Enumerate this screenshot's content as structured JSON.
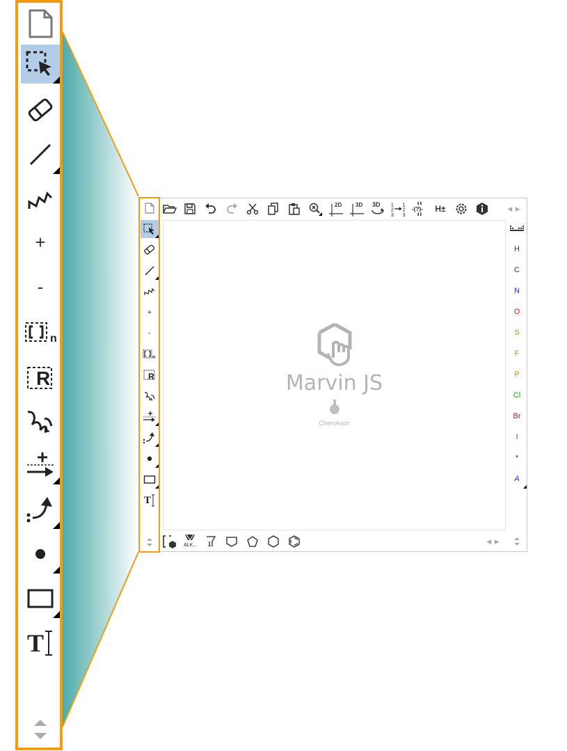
{
  "zoom_toolbar": {
    "tools": [
      {
        "name": "new-document"
      },
      {
        "name": "rectangle-select",
        "active": true
      },
      {
        "name": "eraser"
      },
      {
        "name": "single-bond"
      },
      {
        "name": "chain"
      },
      {
        "name": "increase-charge",
        "label": "+"
      },
      {
        "name": "decrease-charge",
        "label": "-"
      },
      {
        "name": "bracket",
        "label": "n"
      },
      {
        "name": "r-group",
        "label": "R"
      },
      {
        "name": "reaction-arrow-wavy"
      },
      {
        "name": "reaction-arrow-plus"
      },
      {
        "name": "electron-flow-arrow"
      },
      {
        "name": "electron-dot"
      },
      {
        "name": "rectangle-shape"
      },
      {
        "name": "text-tool",
        "label": "T"
      }
    ]
  },
  "editor": {
    "top_toolbar": {
      "clean2d_label": "2D",
      "clean3d_label": "3D",
      "view3d_label": "3D",
      "hydrogen_label": "H±"
    },
    "canvas": {
      "logo_title": "Marvin JS",
      "logo_subtitle": "ChemAxon"
    },
    "elements": [
      "H",
      "C",
      "N",
      "O",
      "S",
      "F",
      "P",
      "Cl",
      "Br",
      "I",
      "*",
      "A"
    ],
    "element_colors": {
      "H": "#333333",
      "C": "#333333",
      "N": "#2b2bd6",
      "O": "#e02020",
      "S": "#999900",
      "F": "#c88a00",
      "P": "#c88a00",
      "Cl": "#1f9f1f",
      "Br": "#8b2a2a",
      "I": "#8a2a8a",
      "*": "#333333",
      "A": "#2b2bd6"
    },
    "bottom_toolbar": {
      "alkane_label": "ALK..."
    }
  },
  "colors": {
    "highlight": "#f39c12",
    "active_tool": "#b3cde9",
    "connector_gradient": [
      "#4eaaa8",
      "#ffffff"
    ]
  }
}
